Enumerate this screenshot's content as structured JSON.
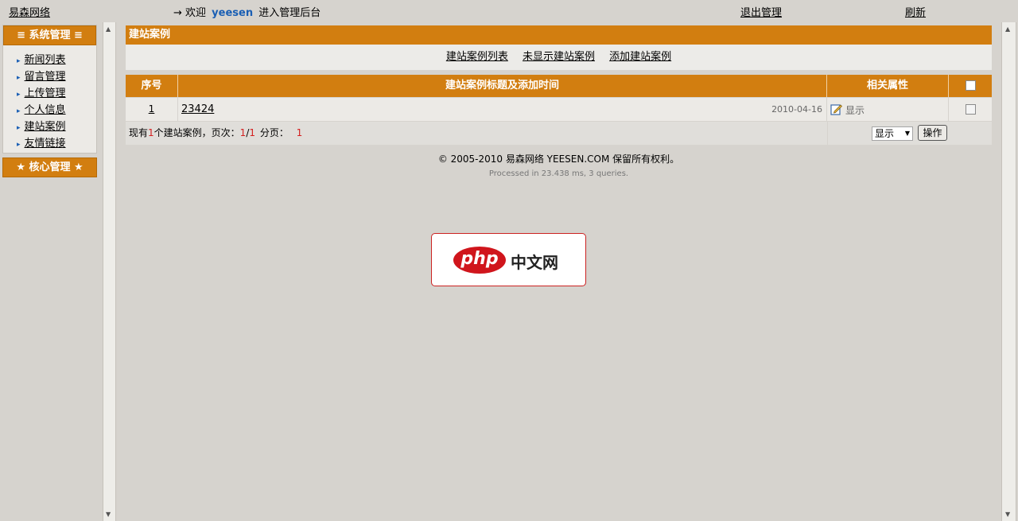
{
  "topbar": {
    "site": "易森网络",
    "welcome_prefix": "→ 欢迎",
    "username": "yeesen",
    "welcome_suffix": "进入管理后台",
    "logout": "退出管理",
    "refresh": "刷新"
  },
  "sidebar": {
    "system_title": "≡ 系统管理 ≡",
    "items": [
      {
        "label": "新闻列表"
      },
      {
        "label": "留言管理"
      },
      {
        "label": "上传管理"
      },
      {
        "label": "个人信息"
      },
      {
        "label": "建站案例"
      },
      {
        "label": "友情链接"
      }
    ],
    "core_title": "★ 核心管理 ★"
  },
  "main": {
    "title": "建站案例",
    "subnav": {
      "list": "建站案例列表",
      "hidden": "未显示建站案例",
      "add": "添加建站案例"
    },
    "table": {
      "headers": {
        "index": "序号",
        "title": "建站案例标题及添加时间",
        "attrs": "相关属性"
      },
      "rows": [
        {
          "index": "1",
          "title": "23424",
          "date": "2010-04-16",
          "attr": "显示"
        }
      ],
      "footer": {
        "count_prefix": "现有",
        "count": "1",
        "count_suffix": "个建站案例，页次：",
        "page_current": "1",
        "page_sep": "/",
        "page_total": "1",
        "pages_label": "分页：",
        "page_link": "1",
        "select_value": "显示",
        "action_button": "操作"
      }
    }
  },
  "footer": {
    "copyright": "© 2005-2010 易森网络 YEESEN.COM 保留所有权利。",
    "processed": "Processed in 23.438 ms, 3 queries."
  },
  "watermark": {
    "logo_text": "php",
    "logo_label": "中文网"
  },
  "colors": {
    "accent": "#d27e10",
    "background": "#d6d3ce",
    "highlight": "#d42020"
  }
}
